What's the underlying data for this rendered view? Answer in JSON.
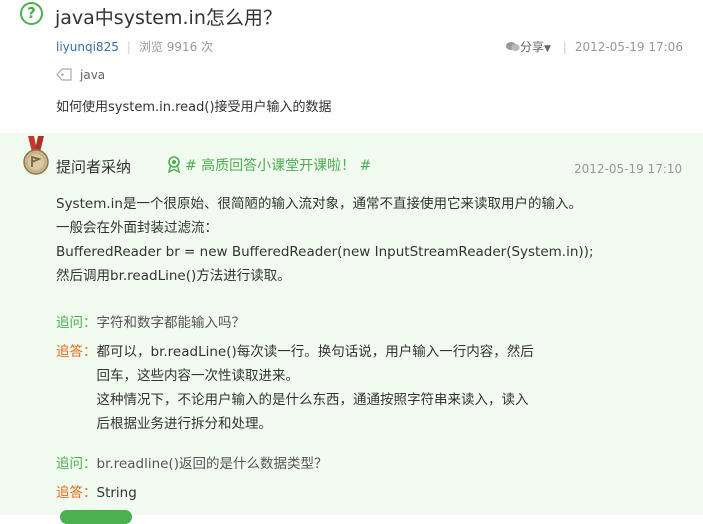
{
  "question": {
    "icon_glyph": "?",
    "title": "java中system.in怎么用？",
    "user": "liyunqi825",
    "views": "浏览 9916 次",
    "share_label": "分享",
    "date": "2012-05-19 17:06",
    "tag": "java",
    "description": "如何使用system.in.read()接受用户输入的数据"
  },
  "answer": {
    "adopted_label": "提问者采纳",
    "promo": "# 高质回答小课堂开课啦！ #",
    "date": "2012-05-19 17:10",
    "lines": [
      "System.in是一个很原始、很简陋的输入流对象，通常不直接使用它来读取用户的输入。",
      "一般会在外面封装过滤流：",
      "BufferedReader br = new BufferedReader(new InputStreamReader(System.in));",
      "然后调用br.readLine()方法进行读取。"
    ],
    "followups": [
      {
        "q_label": "追问：",
        "q_text": "字符和数字都能输入吗？",
        "a_label": "追答：",
        "a_lines": [
          "都可以，br.readLine()每次读一行。换句话说，用户输入一行内容，然后",
          "回车，这些内容一次性读取进来。",
          "这种情况下，不论用户输入的是什么东西，通通按照字符串来读入，读入",
          "后根据业务进行拆分和处理。"
        ]
      },
      {
        "q_label": "追问：",
        "q_text": "br.readline()返回的是什么数据类型？",
        "a_label": "追答：",
        "a_lines": [
          "String"
        ]
      }
    ]
  },
  "colors": {
    "accent_green": "#4caf50",
    "answer_orange": "#e66a16",
    "answer_bg": "#f2fbf0"
  },
  "icons": [
    "question-icon",
    "tag-icon",
    "share-icon",
    "medal-icon",
    "badge-icon"
  ]
}
